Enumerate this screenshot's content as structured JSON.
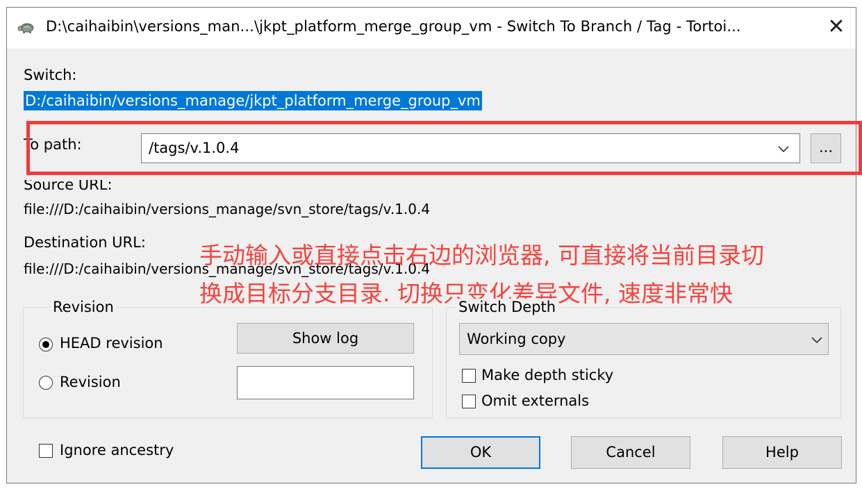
{
  "window": {
    "title": "D:\\caihaibin\\versions_man...\\jkpt_platform_merge_group_vm - Switch To Branch / Tag - Tortoi...",
    "close_glyph": "✕"
  },
  "switch": {
    "label": "Switch:",
    "path": "D:/caihaibin/versions_manage/jkpt_platform_merge_group_vm"
  },
  "to_path": {
    "label": "To path:",
    "value": "/tags/v.1.0.4",
    "browse_label": "..."
  },
  "source_url": {
    "label": "Source URL:",
    "value": "file:///D:/caihaibin/versions_manage/svn_store/tags/v.1.0.4"
  },
  "destination_url": {
    "label": "Destination URL:",
    "value": "file:///D:/caihaibin/versions_manage/svn_store/tags/v.1.0.4"
  },
  "annotation": {
    "line1": "手动输入或直接点击右边的浏览器, 可直接将当前目录切",
    "line2": "换成目标分支目录. 切换只变化差异文件, 速度非常快",
    "color": "#f4443f"
  },
  "revision": {
    "group_label": "Revision",
    "head_label": "HEAD revision",
    "revision_label": "Revision",
    "show_log_label": "Show log",
    "selected": "HEAD revision",
    "revision_value": ""
  },
  "switch_depth": {
    "group_label": "Switch Depth",
    "selected": "Working copy",
    "sticky_label": "Make depth sticky",
    "omit_label": "Omit externals"
  },
  "footer": {
    "ignore_label": "Ignore ancestry",
    "ok_label": "OK",
    "cancel_label": "Cancel",
    "help_label": "Help"
  },
  "colors": {
    "accent": "#0078d7",
    "highlight": "#f23a3a"
  }
}
